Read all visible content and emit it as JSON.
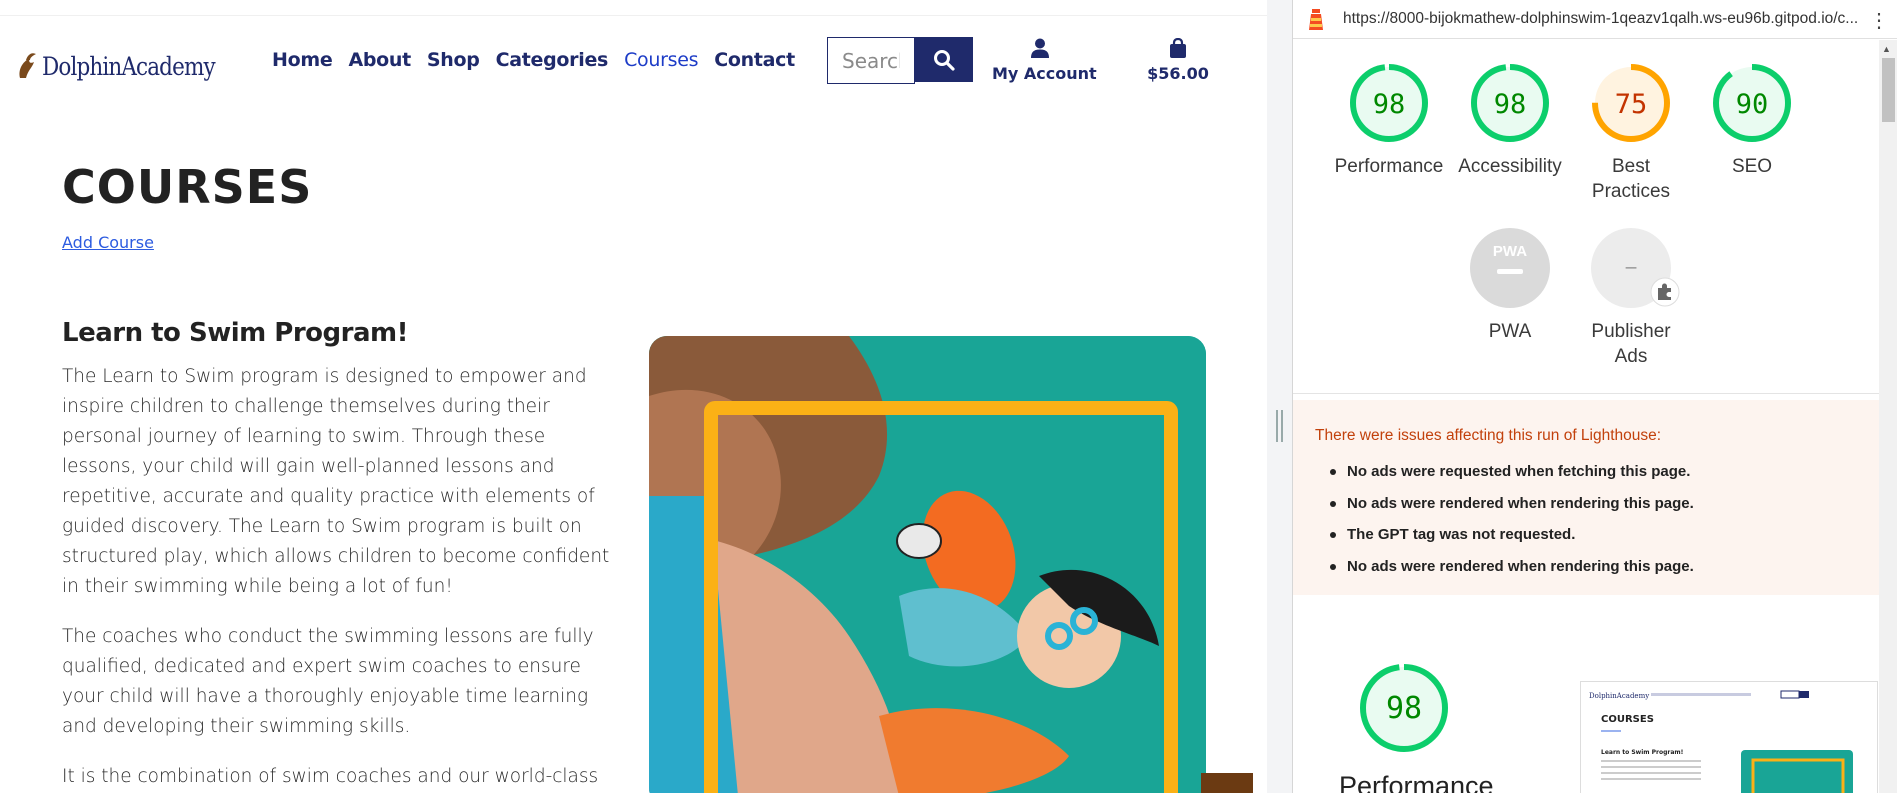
{
  "site": {
    "logo_text": "DolphinAcademy",
    "nav": [
      "Home",
      "About",
      "Shop",
      "Categories",
      "Courses",
      "Contact"
    ],
    "active_nav": "Courses",
    "search_placeholder": "Search",
    "account_label": "My Account",
    "bag_total": "$56.00",
    "page_title": "COURSES",
    "add_course": "Add Course",
    "course_title": "Learn to Swim Program!",
    "paragraphs": [
      "The Learn to Swim program is designed to empower and inspire children to challenge themselves during their personal journey of learning to swim. Through these lessons, your child will gain well-planned lessons and repetitive, accurate and quality practice with elements of guided discovery. The Learn to Swim program is built on structured play, which allows children to become confident in their swimming while being a lot of fun!",
      "The coaches who conduct the swimming lessons are fully qualified, dedicated and expert swim coaches to ensure your child will have a thoroughly enjoyable time learning and developing their swimming skills.",
      "It is the combination of swim coaches and our world-class"
    ]
  },
  "devtools": {
    "url": "https://8000-bijokmathew-dolphinswim-1qeazv1qalh.ws-eu96b.gitpod.io/c...",
    "scores": [
      {
        "label": "Performance",
        "value": "98",
        "color": "#0cce6b",
        "fraction": 0.98
      },
      {
        "label": "Accessibility",
        "value": "98",
        "color": "#0cce6b",
        "fraction": 0.98
      },
      {
        "label": "Best\nPractices",
        "value": "75",
        "color": "#ffa400",
        "fraction": 0.75
      },
      {
        "label": "SEO",
        "value": "90",
        "color": "#0cce6b",
        "fraction": 0.9
      }
    ],
    "pwa_label": "PWA",
    "pwa_badge": "PWA",
    "publisher_label": "Publisher\nAds",
    "publisher_value": "–",
    "warning_title": "There were issues affecting this run of Lighthouse:",
    "warnings": [
      "No ads were requested when fetching this page.",
      "No ads were rendered when rendering this page.",
      "The GPT tag was not requested.",
      "No ads were rendered when rendering this page."
    ],
    "big_score": {
      "label": "Performance",
      "value": "98",
      "fraction": 0.98
    }
  }
}
